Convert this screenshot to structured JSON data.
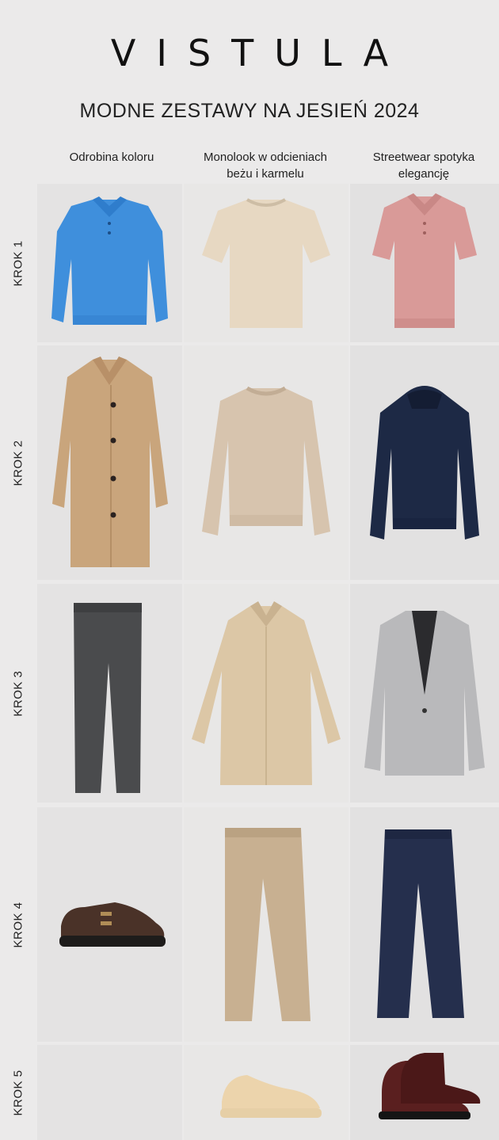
{
  "brand": "VISTULA",
  "title": "MODNE ZESTAWY NA JESIEŃ 2024",
  "columns": [
    {
      "label": "Odrobina koloru"
    },
    {
      "label": "Monolook w odcieniach beżu i karmelu"
    },
    {
      "label": "Streetwear spotyka elegancję"
    }
  ],
  "rows": [
    {
      "label": "KROK 1",
      "items": [
        "blue-polo-sweater",
        "beige-tshirt",
        "pink-polo-shirt"
      ]
    },
    {
      "label": "KROK 2",
      "items": [
        "camel-coat",
        "beige-sweatshirt",
        "navy-hoodie"
      ]
    },
    {
      "label": "KROK 3",
      "items": [
        "grey-check-trousers",
        "beige-trench-coat",
        "grey-blazer"
      ]
    },
    {
      "label": "KROK 4",
      "items": [
        "brown-monk-shoe",
        "beige-trousers",
        "navy-trousers"
      ]
    },
    {
      "label": "KROK 5",
      "items": [
        "",
        "beige-sneaker",
        "burgundy-chelsea-boots"
      ]
    }
  ],
  "colors": {
    "blue": "#3f8fdc",
    "beige_tee": "#e7d8c2",
    "pink": "#d99a98",
    "camel": "#c9a57c",
    "beige_sweat": "#d7c4ae",
    "navy": "#1d2945",
    "charcoal": "#4a4b4d",
    "trench": "#dcc7a6",
    "grey_blazer": "#b9b9bb",
    "brown": "#4a3228",
    "khaki": "#c8b091",
    "burgundy": "#5a1f1f"
  }
}
